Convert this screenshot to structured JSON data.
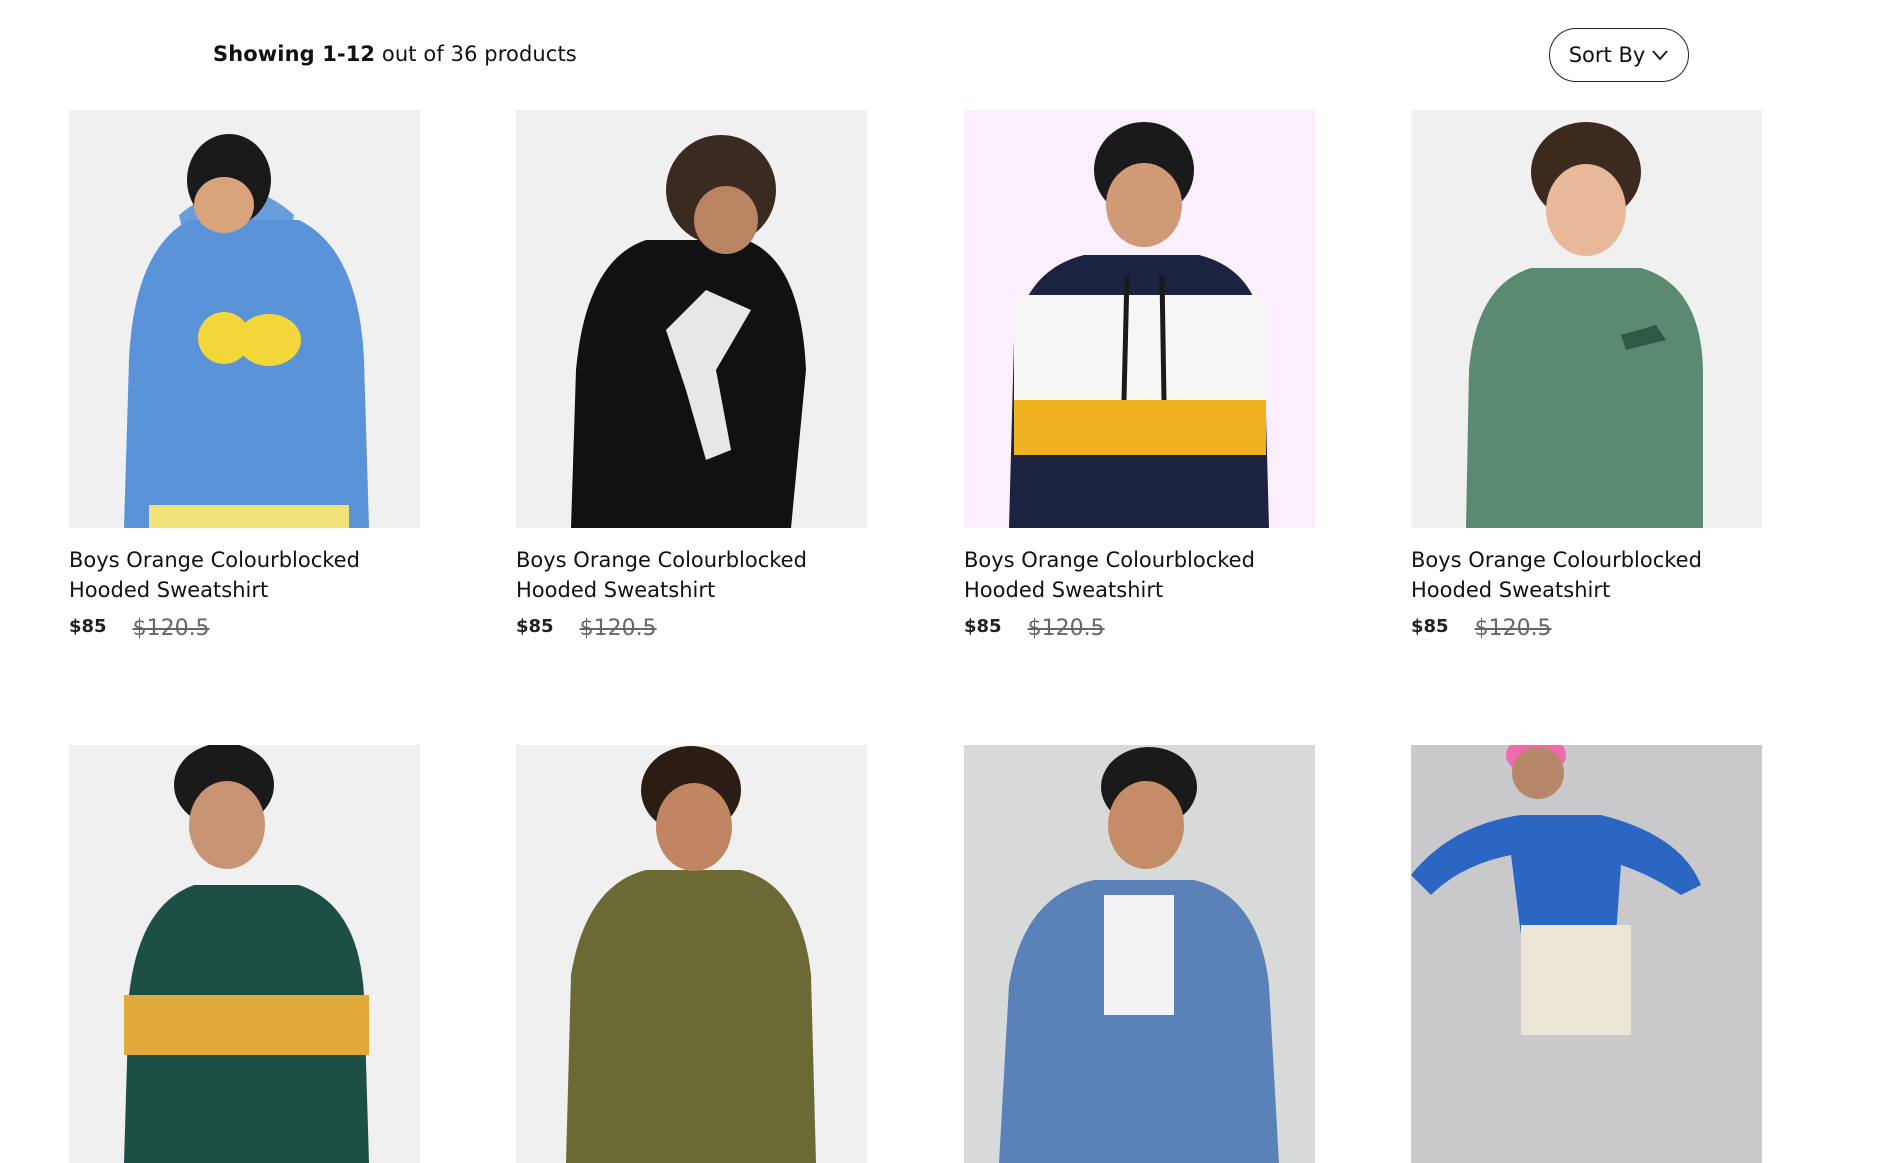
{
  "toolbar": {
    "showing_bold": "Showing 1-12",
    "showing_rest": " out of 36 products",
    "sort_label": "Sort By"
  },
  "products": [
    {
      "title": "Boys Orange Colourblocked Hooded Sweatshirt",
      "price": "$85",
      "old_price": "$120.5",
      "bg": "#f0f0f0",
      "garment": "#5b93d8",
      "icon": "blue-lemon-hoodie-image"
    },
    {
      "title": "Boys Orange Colourblocked Hooded Sweatshirt",
      "price": "$85",
      "old_price": "$120.5",
      "bg": "#f0f0f0",
      "garment": "#111111",
      "icon": "black-footballer-hoodie-image"
    },
    {
      "title": "Boys Orange Colourblocked Hooded Sweatshirt",
      "price": "$85",
      "old_price": "$120.5",
      "bg": "#fbeffd",
      "garment": "#1c2340",
      "icon": "colourblock-hoodie-image"
    },
    {
      "title": "Boys Orange Colourblocked Hooded Sweatshirt",
      "price": "$85",
      "old_price": "$120.5",
      "bg": "#f0f0f0",
      "garment": "#5b8a72",
      "icon": "green-sweatshirt-image"
    },
    {
      "bg": "#f0f0f0",
      "garment": "#1e4f45",
      "icon": "green-track-jacket-image"
    },
    {
      "bg": "#f0f0f0",
      "garment": "#6b6a34",
      "icon": "olive-quilted-jacket-image"
    },
    {
      "bg": "#d8dada",
      "garment": "#5a82b8",
      "icon": "denim-jacket-image"
    },
    {
      "bg": "#c9c9cc",
      "garment": "#2a66c2",
      "icon": "blue-sweatshirt-image"
    }
  ]
}
